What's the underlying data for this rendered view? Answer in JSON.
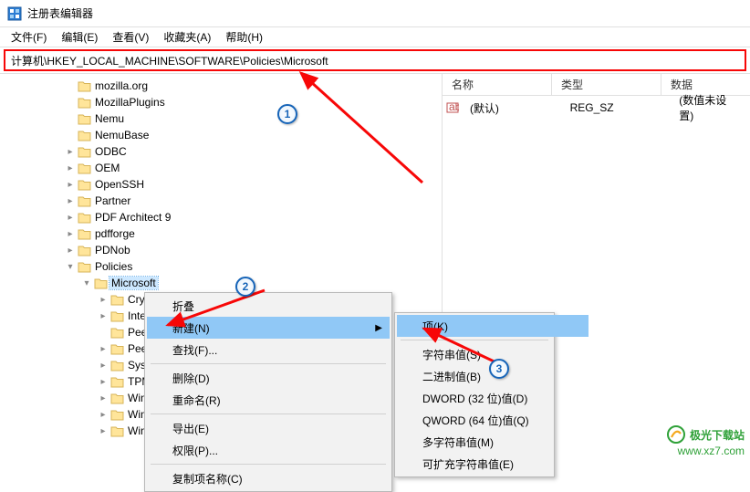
{
  "window": {
    "title": "注册表编辑器"
  },
  "menu": {
    "file": "文件(F)",
    "edit": "编辑(E)",
    "view": "查看(V)",
    "fav": "收藏夹(A)",
    "help": "帮助(H)"
  },
  "address": {
    "value": "计算机\\HKEY_LOCAL_MACHINE\\SOFTWARE\\Policies\\Microsoft"
  },
  "tree": [
    {
      "indent": 70,
      "twisty": "",
      "label": "mozilla.org"
    },
    {
      "indent": 70,
      "twisty": "",
      "label": "MozillaPlugins"
    },
    {
      "indent": 70,
      "twisty": "",
      "label": "Nemu"
    },
    {
      "indent": 70,
      "twisty": "",
      "label": "NemuBase"
    },
    {
      "indent": 70,
      "twisty": ">",
      "label": "ODBC"
    },
    {
      "indent": 70,
      "twisty": ">",
      "label": "OEM"
    },
    {
      "indent": 70,
      "twisty": ">",
      "label": "OpenSSH"
    },
    {
      "indent": 70,
      "twisty": ">",
      "label": "Partner"
    },
    {
      "indent": 70,
      "twisty": ">",
      "label": "PDF Architect 9"
    },
    {
      "indent": 70,
      "twisty": ">",
      "label": "pdfforge"
    },
    {
      "indent": 70,
      "twisty": ">",
      "label": "PDNob"
    },
    {
      "indent": 70,
      "twisty": "v",
      "label": "Policies"
    },
    {
      "indent": 88,
      "twisty": "v",
      "label": "Microsoft",
      "selected": true
    },
    {
      "indent": 106,
      "twisty": ">",
      "label": "Crypto"
    },
    {
      "indent": 106,
      "twisty": ">",
      "label": "Intern"
    },
    {
      "indent": 106,
      "twisty": "",
      "label": "PeerD"
    },
    {
      "indent": 106,
      "twisty": ">",
      "label": "Peern"
    },
    {
      "indent": 106,
      "twisty": ">",
      "label": "Syster"
    },
    {
      "indent": 106,
      "twisty": ">",
      "label": "TPM"
    },
    {
      "indent": 106,
      "twisty": ">",
      "label": "Windo"
    },
    {
      "indent": 106,
      "twisty": ">",
      "label": "Windo"
    },
    {
      "indent": 106,
      "twisty": ">",
      "label": "Windo"
    }
  ],
  "list": {
    "cols": {
      "name": "名称",
      "type": "类型",
      "data": "数据"
    },
    "rows": [
      {
        "name": "(默认)",
        "type": "REG_SZ",
        "data": "(数值未设置)"
      }
    ]
  },
  "ctx1": {
    "collapse": "折叠",
    "new": "新建(N)",
    "find": "查找(F)...",
    "delete": "删除(D)",
    "rename": "重命名(R)",
    "export": "导出(E)",
    "perm": "权限(P)...",
    "copykey": "复制项名称(C)"
  },
  "ctx2": {
    "key": "项(K)",
    "string": "字符串值(S)",
    "binary": "二进制值(B)",
    "dword": "DWORD (32 位)值(D)",
    "qword": "QWORD (64 位)值(Q)",
    "multi": "多字符串值(M)",
    "expand": "可扩充字符串值(E)"
  },
  "annotations": {
    "c1": "1",
    "c2": "2",
    "c3": "3"
  },
  "watermark": {
    "brand": "极光下载站",
    "url": "www.xz7.com"
  }
}
